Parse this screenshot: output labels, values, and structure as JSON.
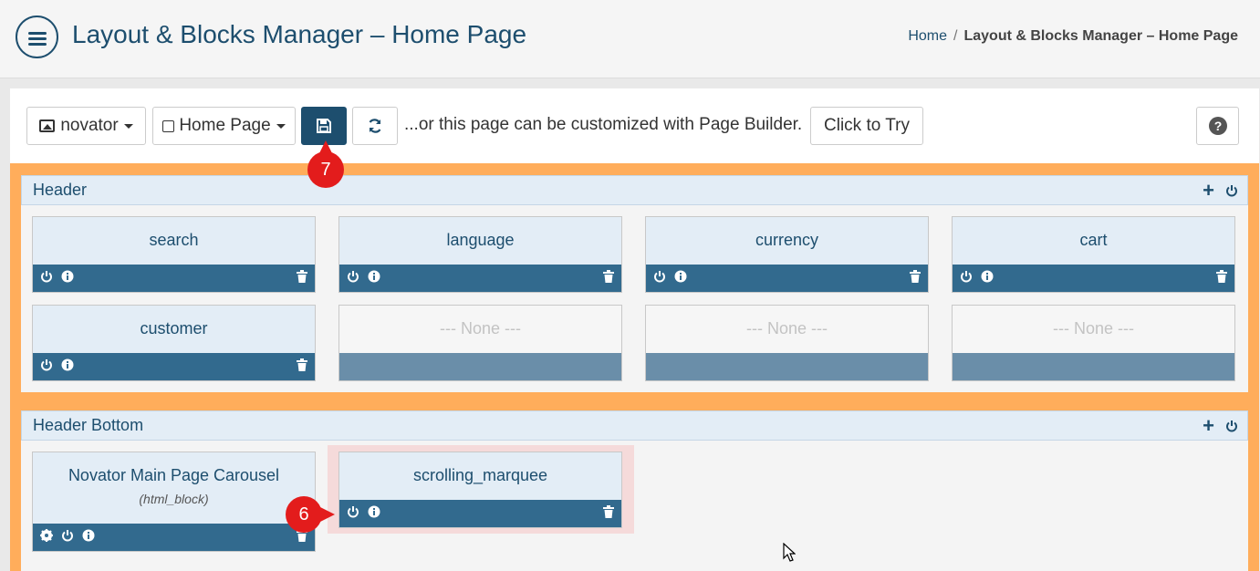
{
  "header": {
    "title": "Layout & Blocks Manager – Home Page",
    "breadcrumb": {
      "home": "Home",
      "separator": "/",
      "current": "Layout & Blocks Manager – Home Page"
    }
  },
  "toolbar": {
    "theme_label": "novator",
    "page_label": "Home Page",
    "page_builder_text": "...or this page can be customized with Page Builder.",
    "try_label": "Click to Try"
  },
  "markers": {
    "save": "7",
    "scrolling_power": "6"
  },
  "sections": [
    {
      "title": "Header",
      "blocks": [
        {
          "name": "search"
        },
        {
          "name": "language"
        },
        {
          "name": "currency"
        },
        {
          "name": "cart"
        },
        {
          "name": "customer"
        },
        {
          "name": "--- None ---"
        },
        {
          "name": "--- None ---"
        },
        {
          "name": "--- None ---"
        }
      ]
    },
    {
      "title": "Header Bottom",
      "blocks": [
        {
          "name": "Novator Main Page Carousel",
          "sub": "(html_block)"
        },
        {
          "name": "scrolling_marquee"
        }
      ]
    }
  ],
  "colors": {
    "primary": "#1d4e6e",
    "orange": "#ffad5b",
    "block_bar": "#326a8e",
    "marker": "#e31c1c"
  }
}
